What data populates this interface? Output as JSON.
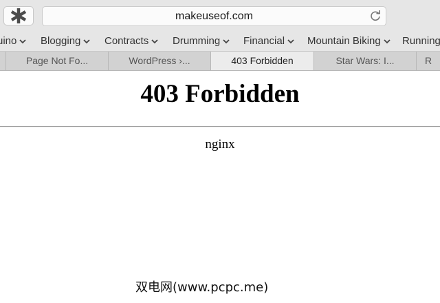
{
  "browser": {
    "address_bar": {
      "url": "makeuseof.com"
    },
    "bookmarks": [
      "uino",
      "Blogging",
      "Contracts",
      "Drumming",
      "Financial",
      "Mountain Biking",
      "Running"
    ],
    "tabs": [
      "Page Not Fo...",
      "WordPress ›...",
      "403 Forbidden",
      "Star Wars: I...",
      "R"
    ],
    "active_tab_index": 2,
    "icons": {
      "extension": "asterisk-icon",
      "reload": "reload-icon",
      "bookmark_menu": "chevron-down-icon"
    }
  },
  "page": {
    "heading": "403 Forbidden",
    "server": "nginx"
  },
  "watermark": "双电网(www.pcpc.me)"
}
